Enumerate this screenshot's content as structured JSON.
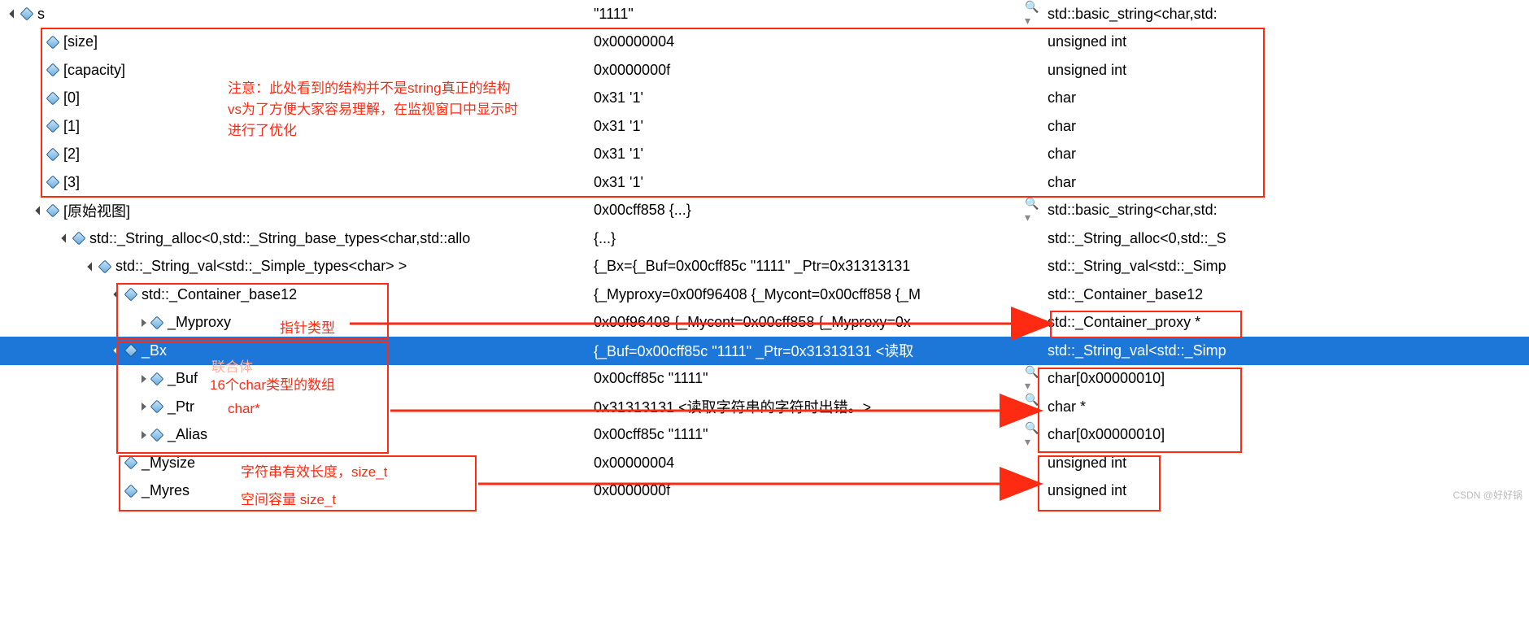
{
  "rows": [
    {
      "indent": 0,
      "exp": "expanded",
      "name": "s",
      "value": "\"1111\"",
      "mag": true,
      "type": "std::basic_string<char,std:",
      "selected": false
    },
    {
      "indent": 1,
      "exp": null,
      "name": "[size]",
      "value": "0x00000004",
      "mag": false,
      "type": "unsigned int",
      "selected": false
    },
    {
      "indent": 1,
      "exp": null,
      "name": "[capacity]",
      "value": "0x0000000f",
      "mag": false,
      "type": "unsigned int",
      "selected": false
    },
    {
      "indent": 1,
      "exp": null,
      "name": "[0]",
      "value": "0x31 '1'",
      "mag": false,
      "type": "char",
      "selected": false
    },
    {
      "indent": 1,
      "exp": null,
      "name": "[1]",
      "value": "0x31 '1'",
      "mag": false,
      "type": "char",
      "selected": false
    },
    {
      "indent": 1,
      "exp": null,
      "name": "[2]",
      "value": "0x31 '1'",
      "mag": false,
      "type": "char",
      "selected": false
    },
    {
      "indent": 1,
      "exp": null,
      "name": "[3]",
      "value": "0x31 '1'",
      "mag": false,
      "type": "char",
      "selected": false
    },
    {
      "indent": 1,
      "exp": "expanded",
      "name": "[原始视图]",
      "value": "0x00cff858 {...}",
      "mag": true,
      "type": "std::basic_string<char,std:",
      "selected": false
    },
    {
      "indent": 2,
      "exp": "expanded",
      "name": "std::_String_alloc<0,std::_String_base_types<char,std::allo",
      "value": "{...}",
      "mag": false,
      "type": "std::_String_alloc<0,std::_S",
      "selected": false
    },
    {
      "indent": 3,
      "exp": "expanded",
      "name": "std::_String_val<std::_Simple_types<char> >",
      "value": "{_Bx={_Buf=0x00cff85c \"1111\" _Ptr=0x31313131",
      "mag": false,
      "type": "std::_String_val<std::_Simp",
      "selected": false
    },
    {
      "indent": 4,
      "exp": "expanded",
      "name": "std::_Container_base12",
      "value": "{_Myproxy=0x00f96408 {_Mycont=0x00cff858 {_M",
      "mag": false,
      "type": "std::_Container_base12",
      "selected": false
    },
    {
      "indent": 5,
      "exp": "collapsed",
      "name": "_Myproxy",
      "value": "0x00f96408 {_Mycont=0x00cff858 {_Myproxy=0x",
      "mag": false,
      "type": "std::_Container_proxy *",
      "selected": false
    },
    {
      "indent": 4,
      "exp": "expanded",
      "name": "_Bx",
      "value": "{_Buf=0x00cff85c \"1111\" _Ptr=0x31313131 <读取",
      "mag": false,
      "type": "std::_String_val<std::_Simp",
      "selected": true
    },
    {
      "indent": 5,
      "exp": "collapsed",
      "name": "_Buf",
      "value": "0x00cff85c \"1111\"",
      "mag": true,
      "type": "char[0x00000010]",
      "selected": false
    },
    {
      "indent": 5,
      "exp": "collapsed",
      "name": "_Ptr",
      "value": "0x31313131 <读取字符串的字符时出错。>",
      "mag": true,
      "type": "char *",
      "selected": false
    },
    {
      "indent": 5,
      "exp": "collapsed",
      "name": "_Alias",
      "value": "0x00cff85c \"1111\"",
      "mag": true,
      "type": "char[0x00000010]",
      "selected": false
    },
    {
      "indent": 4,
      "exp": null,
      "name": "_Mysize",
      "value": "0x00000004",
      "mag": false,
      "type": "unsigned int",
      "selected": false
    },
    {
      "indent": 4,
      "exp": null,
      "name": "_Myres",
      "value": "0x0000000f",
      "mag": false,
      "type": "unsigned int",
      "selected": false
    }
  ],
  "annotations": {
    "note1": "注意：此处看到的结构并不是string真正的结构",
    "note2": "vs为了方便大家容易理解，在监视窗口中显示时",
    "note3": "进行了优化",
    "a_pointer": "指针类型",
    "a_union": "联合体",
    "a_16char": "16个char类型的数组",
    "a_charstar": "char*",
    "a_mysize": "字符串有效长度，size_t",
    "a_myres": "空间容量  size_t"
  },
  "watermark": "CSDN @好好锅"
}
